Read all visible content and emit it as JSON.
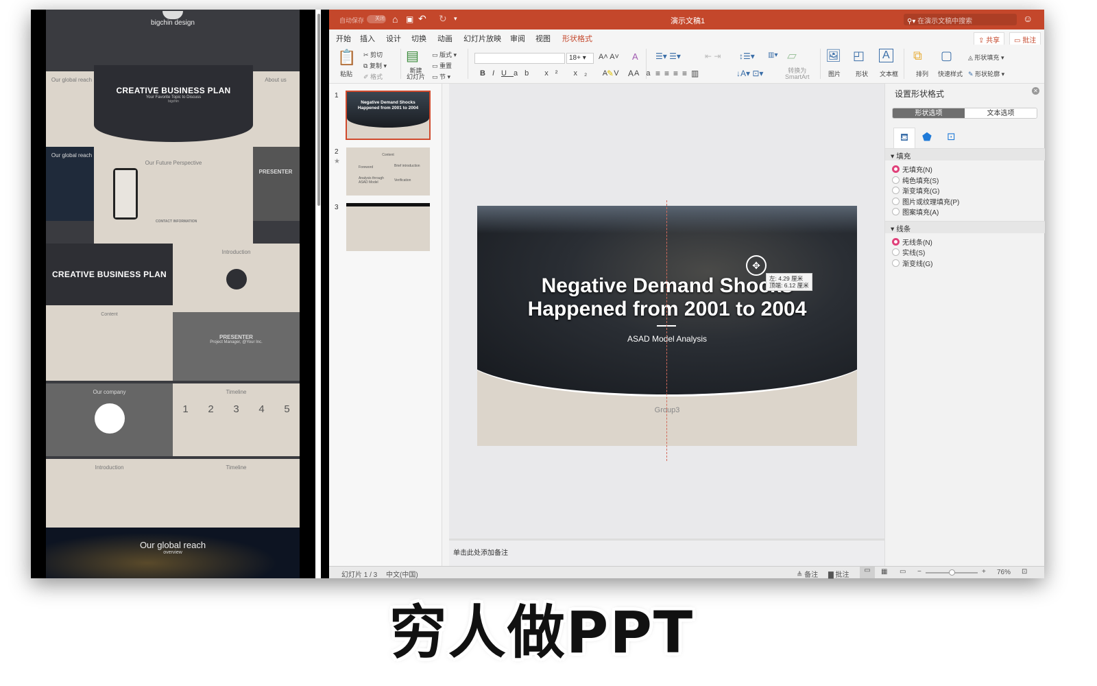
{
  "left_preview": {
    "brand": "bigchin design",
    "hero_title": "CREATIVE BUSINESS PLAN",
    "hero_subtitle": "Your Favorite Topic to Discuss",
    "hero_author": "bigchin",
    "future": "Our Future Perspective",
    "contact": "CONTACT INFORMATION",
    "global": "Our global reach",
    "global_sub": "overview",
    "about": "About us",
    "presenter": "PRESENTER",
    "presenter_sub": "Project Manager, @Your Inc.",
    "content": "Content",
    "introduction": "Introduction",
    "company": "Our company",
    "timeline": "Timeline",
    "timeline_nums": [
      "1",
      "2",
      "3",
      "4",
      "5"
    ]
  },
  "titlebar": {
    "autosave": "自动保存",
    "autosave_state": "关闭",
    "doc_title": "演示文稿1",
    "search_placeholder": "在演示文稿中搜索"
  },
  "tabs": [
    "开始",
    "插入",
    "设计",
    "切换",
    "动画",
    "幻灯片放映",
    "审阅",
    "视图",
    "形状格式"
  ],
  "active_tab": "开始",
  "accent_tab": "形状格式",
  "share": "共享",
  "comments": "批注",
  "ribbon": {
    "paste": "粘贴",
    "cut": "剪切",
    "copy": "复制",
    "format": "格式",
    "new_slide": "新建\n幻灯片",
    "layout": "版式",
    "reset": "重置",
    "section": "节",
    "font_size": "18+",
    "convert_smartart": "转换为\nSmartArt",
    "picture": "图片",
    "shape": "形状",
    "textbox": "文本框",
    "arrange": "排列",
    "quick_styles": "快速样式",
    "shape_fill": "形状填充",
    "shape_outline": "形状轮廓"
  },
  "thumbnails": [
    {
      "num": "1",
      "title": "Negative Demand Shocks",
      "title2": "Happened  from 2001 to 2004",
      "selected": true
    },
    {
      "num": "2",
      "heading": "Content",
      "items": [
        "Foreword",
        "Brief introduction",
        "Analysis through ASAD Model",
        "Verification"
      ]
    },
    {
      "num": "3"
    }
  ],
  "slide": {
    "title1": "Negative Demand Shocks",
    "title2": "Happened  from 2001 to 2004",
    "subtitle": "ASAD Model Analysis",
    "group_label": "Group3",
    "tooltip_left": "左: 4.29 厘米",
    "tooltip_top": "顶端: 6.12 厘米"
  },
  "notes_placeholder": "单击此处添加备注",
  "pane": {
    "title": "设置形状格式",
    "tab_shape": "形状选项",
    "tab_text": "文本选项",
    "fill_header": "填充",
    "fill_options": [
      "无填充(N)",
      "纯色填充(S)",
      "渐变填充(G)",
      "图片或纹理填充(P)",
      "图案填充(A)"
    ],
    "fill_selected": 0,
    "line_header": "线条",
    "line_options": [
      "无线条(N)",
      "实线(S)",
      "渐变线(G)"
    ],
    "line_selected": 0
  },
  "status": {
    "slide": "幻灯片 1 / 3",
    "lang": "中文(中国)",
    "notes": "备注",
    "comments": "批注",
    "zoom": "76%"
  },
  "zoom_fraction": 0.5,
  "caption": "穷人做PPT",
  "colors": {
    "titlebar": "#c4472b",
    "accent": "#c4472b",
    "radio_on": "#e0417a",
    "slide_beige": "#dcd5cb"
  }
}
